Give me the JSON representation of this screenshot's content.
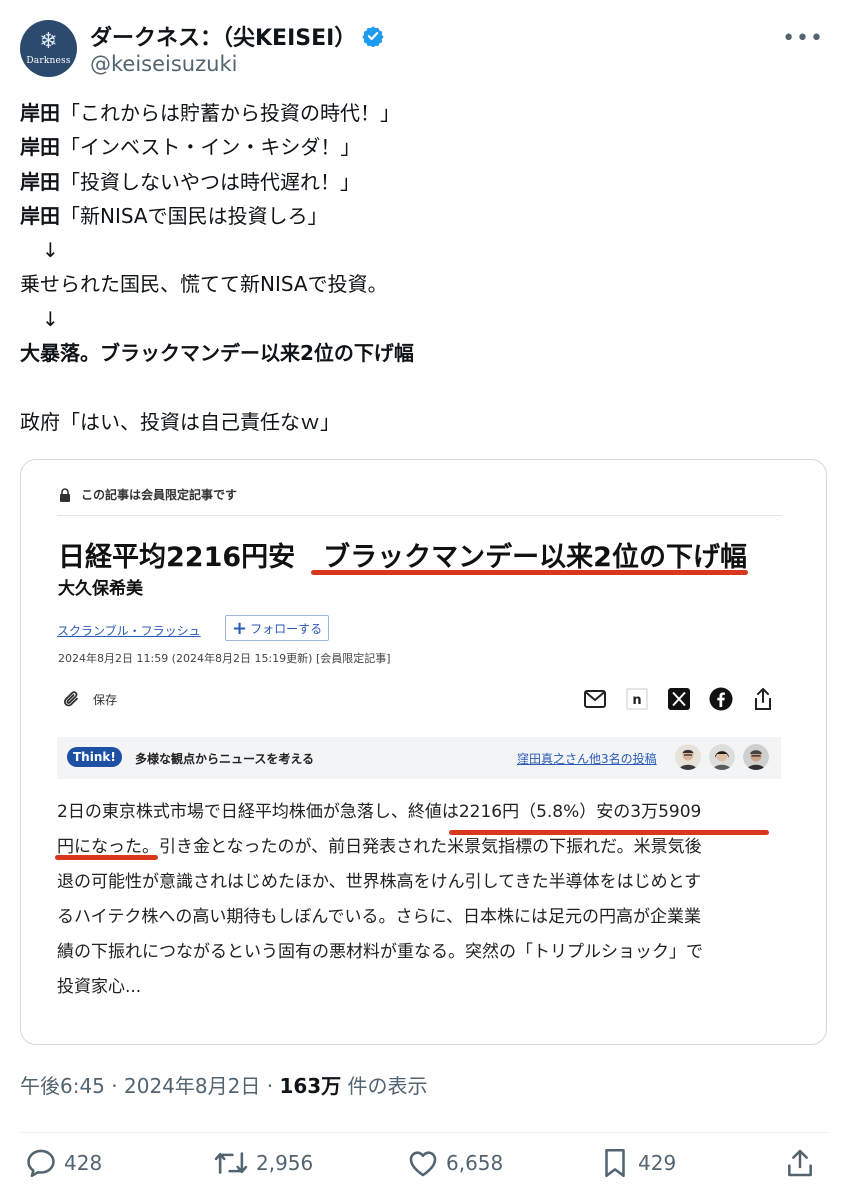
{
  "header": {
    "avatar_label": "Darkness",
    "display_name": "ダークネス：（尖KEISEI）",
    "handle": "@keiseisuzuki"
  },
  "tweet": {
    "lines": [
      {
        "speaker": "岸田",
        "text": "「これからは貯蓄から投資の時代！」"
      },
      {
        "speaker": "岸田",
        "text": "「インベスト・イン・キシダ！」"
      },
      {
        "speaker": "岸田",
        "text": "「投資しないやつは時代遅れ！」"
      },
      {
        "speaker": "岸田",
        "text": "「新NISAで国民は投資しろ」"
      }
    ],
    "arrow": "↓",
    "line5": "乗せられた国民、慌てて新NISAで投資。",
    "line6": "大暴落。ブラックマンデー以来2位の下げ幅",
    "line7": "政府「はい、投資は自己責任なｗ」"
  },
  "card": {
    "members_only": "この記事は会員限定記事です",
    "headline_part1": "日経平均2216円安",
    "headline_part2": "ブラックマンデー以来2位の下げ幅",
    "author": "大久保希美",
    "series": "スクランブル・フラッシュ",
    "follow": "フォローする",
    "dateline": "2024年8月2日 11:59 (2024年8月2日 15:19更新) [会員限定記事]",
    "save": "保存",
    "think_badge": "Think!",
    "think_label": "多様な観点からニュースを考える",
    "think_posts": "窪田真之さん他3名の投稿",
    "article_lines": [
      "2日の東京株式市場で日経平均株価が急落し、終値は2216円（5.8%）安の3万5909",
      "円になった。引き金となったのが、前日発表された米景気指標の下振れだ。米景気後",
      "退の可能性が意識されはじめたほか、世界株高をけん引してきた半導体をはじめとす",
      "るハイテク株への高い期待もしぼんでいる。さらに、日本株には足元の円高が企業業",
      "績の下振れにつながるという固有の悪材料が重なる。突然の「トリプルショック」で",
      "投資家心..."
    ]
  },
  "meta": {
    "time": "午後6:45",
    "dot": "·",
    "date": "2024年8月2日",
    "views": "163万",
    "views_label": "件の表示"
  },
  "actions": {
    "replies": "428",
    "reposts": "2,956",
    "likes": "6,658",
    "bookmarks": "429"
  },
  "colors": {
    "accent_red": "#d9381e",
    "verified_blue": "#1d9bf0",
    "link_blue": "#2b5bb8"
  }
}
